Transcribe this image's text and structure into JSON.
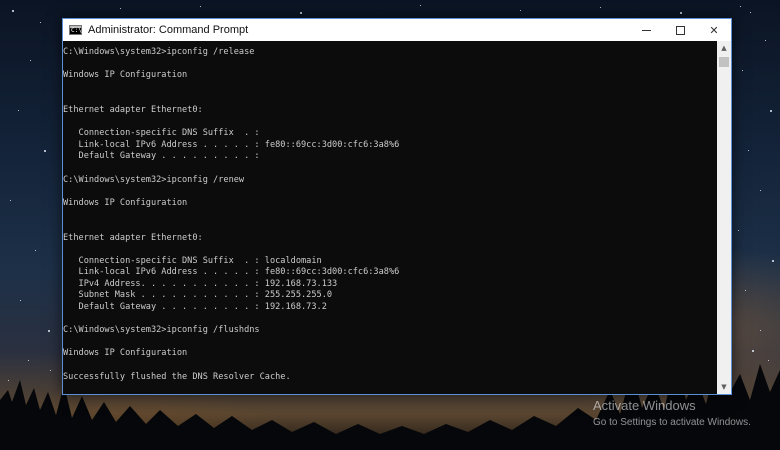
{
  "window": {
    "title": "Administrator: Command Prompt",
    "icon": "cmd-icon",
    "icon_glyph": "C:\\",
    "buttons": {
      "minimize": "minimize-icon",
      "maximize": "maximize-icon",
      "close": "close-icon",
      "close_glyph": "✕"
    }
  },
  "console": {
    "lines": [
      "C:\\Windows\\system32>ipconfig /release",
      "",
      "Windows IP Configuration",
      "",
      "",
      "Ethernet adapter Ethernet0:",
      "",
      "   Connection-specific DNS Suffix  . :",
      "   Link-local IPv6 Address . . . . . : fe80::69cc:3d00:cfc6:3a8%6",
      "   Default Gateway . . . . . . . . . :",
      "",
      "C:\\Windows\\system32>ipconfig /renew",
      "",
      "Windows IP Configuration",
      "",
      "",
      "Ethernet adapter Ethernet0:",
      "",
      "   Connection-specific DNS Suffix  . : localdomain",
      "   Link-local IPv6 Address . . . . . : fe80::69cc:3d00:cfc6:3a8%6",
      "   IPv4 Address. . . . . . . . . . . : 192.168.73.133",
      "   Subnet Mask . . . . . . . . . . . : 255.255.255.0",
      "   Default Gateway . . . . . . . . . : 192.168.73.2",
      "",
      "C:\\Windows\\system32>ipconfig /flushdns",
      "",
      "Windows IP Configuration",
      "",
      "Successfully flushed the DNS Resolver Cache."
    ]
  },
  "scrollbar": {
    "up_glyph": "▲",
    "down_glyph": "▼"
  },
  "watermark": {
    "title": "Activate Windows",
    "subtitle": "Go to Settings to activate Windows."
  },
  "colors": {
    "console_bg": "#0c0c0c",
    "console_text": "#cccccc",
    "window_border": "#5b8fd6"
  }
}
